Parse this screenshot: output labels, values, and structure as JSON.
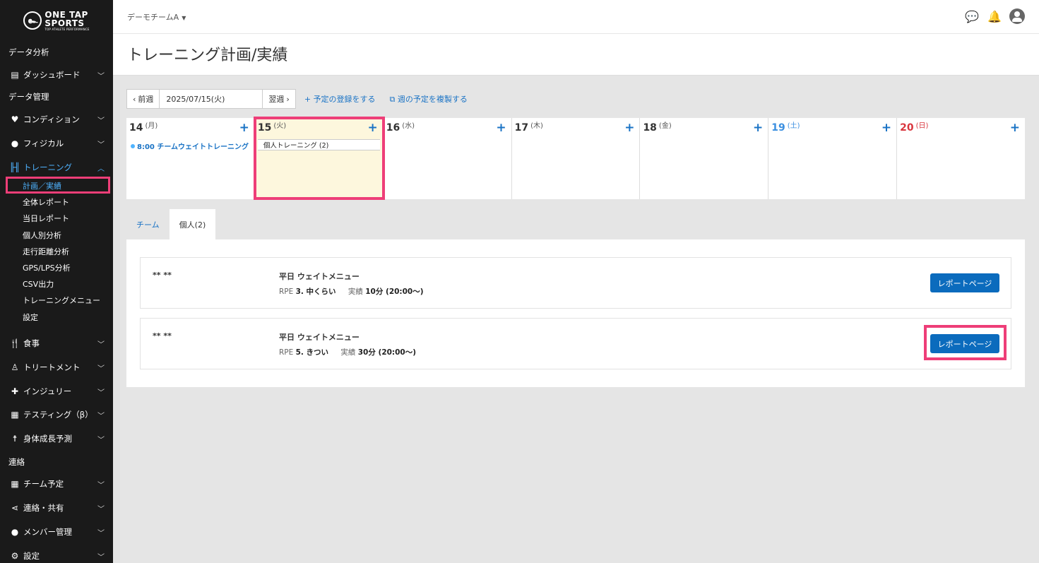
{
  "brand": {
    "mark": "๛",
    "line1": "ONE TAP",
    "line2": "SPORTS",
    "line3": "TOP ATHLETE PERFORMANCE"
  },
  "sidebar": {
    "section_analysis": "データ分析",
    "dashboard": "ダッシュボード",
    "section_manage": "データ管理",
    "condition": "コンディション",
    "physical": "フィジカル",
    "training": "トレーニング",
    "training_sub": [
      "計画／実績",
      "全体レポート",
      "当日レポート",
      "個人別分析",
      "走行距離分析",
      "GPS/LPS分析",
      "CSV出力",
      "トレーニングメニュー",
      "設定"
    ],
    "meal": "食事",
    "treatment": "トリートメント",
    "injury": "インジュリー",
    "testing": "テスティング（β）",
    "growth": "身体成長予測",
    "section_contact": "連絡",
    "team_schedule": "チーム予定",
    "share": "連絡・共有",
    "members": "メンバー管理",
    "settings": "設定"
  },
  "header": {
    "team": "デーモチームA",
    "title": "トレーニング計画/実績"
  },
  "weeknav": {
    "prev": "前週",
    "date": "2025/07/15(火)",
    "next": "翌週",
    "add_schedule": "+ 予定の登録をする",
    "copy_week": "週の予定を複製する"
  },
  "calendar": {
    "days": [
      {
        "num": "14",
        "dow": "(月)"
      },
      {
        "num": "15",
        "dow": "(火)"
      },
      {
        "num": "16",
        "dow": "(水)"
      },
      {
        "num": "17",
        "dow": "(木)"
      },
      {
        "num": "18",
        "dow": "(金)"
      },
      {
        "num": "19",
        "dow": "(土)"
      },
      {
        "num": "20",
        "dow": "(日)"
      }
    ],
    "add_symbol": "+",
    "team_event": "8:00 チームウェイトトレーニング",
    "personal_event": "個人トレーニング (2)"
  },
  "tabs": {
    "team": "チーム",
    "personal": "個人(2)"
  },
  "records": [
    {
      "name": "** **",
      "title": "平日 ウェイトメニュー",
      "rpe_label": "RPE",
      "rpe_value": "3. 中くらい",
      "actual_label": "実績",
      "actual_value": "10分 (20:00〜)",
      "button": "レポートページ"
    },
    {
      "name": "** **",
      "title": "平日 ウェイトメニュー",
      "rpe_label": "RPE",
      "rpe_value": "5. きつい",
      "actual_label": "実績",
      "actual_value": "30分 (20:00〜)",
      "button": "レポートページ"
    }
  ],
  "colors": {
    "accent": "#1a73c5",
    "highlight": "#ee3e78",
    "sidebar_bg": "#1a1a1a",
    "today_bg": "#fdf7dd"
  }
}
